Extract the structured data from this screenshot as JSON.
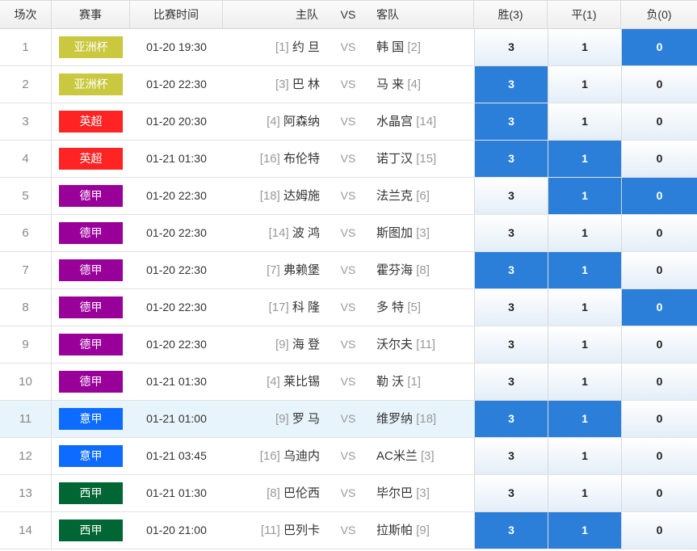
{
  "headers": {
    "no": "场次",
    "league": "赛事",
    "time": "比赛时间",
    "home": "主队",
    "vs": "VS",
    "away": "客队",
    "win": "胜(3)",
    "draw": "平(1)",
    "lose": "负(0)"
  },
  "colors": {
    "亚洲杯": "#c9c83e",
    "英超": "#ff2323",
    "德甲": "#990099",
    "意甲": "#0d6cff",
    "西甲": "#006633",
    "selected": "#2b7fd9"
  },
  "highlight_row": 10,
  "rows": [
    {
      "no": "1",
      "league": "亚洲杯",
      "time": "01-20 19:30",
      "home_rank": "[1]",
      "home": "约 旦",
      "vs": "VS",
      "away": "韩 国",
      "away_rank": "[2]",
      "win": "3",
      "draw": "1",
      "lose": "0",
      "sel": [
        false,
        false,
        true
      ]
    },
    {
      "no": "2",
      "league": "亚洲杯",
      "time": "01-20 22:30",
      "home_rank": "[3]",
      "home": "巴 林",
      "vs": "VS",
      "away": "马 来",
      "away_rank": "[4]",
      "win": "3",
      "draw": "1",
      "lose": "0",
      "sel": [
        true,
        false,
        false
      ]
    },
    {
      "no": "3",
      "league": "英超",
      "time": "01-20 20:30",
      "home_rank": "[4]",
      "home": "阿森纳",
      "vs": "VS",
      "away": "水晶宫",
      "away_rank": "[14]",
      "win": "3",
      "draw": "1",
      "lose": "0",
      "sel": [
        true,
        false,
        false
      ]
    },
    {
      "no": "4",
      "league": "英超",
      "time": "01-21 01:30",
      "home_rank": "[16]",
      "home": "布伦特",
      "vs": "VS",
      "away": "诺丁汉",
      "away_rank": "[15]",
      "win": "3",
      "draw": "1",
      "lose": "0",
      "sel": [
        true,
        true,
        false
      ]
    },
    {
      "no": "5",
      "league": "德甲",
      "time": "01-20 22:30",
      "home_rank": "[18]",
      "home": "达姆施",
      "vs": "VS",
      "away": "法兰克",
      "away_rank": "[6]",
      "win": "3",
      "draw": "1",
      "lose": "0",
      "sel": [
        false,
        true,
        true
      ]
    },
    {
      "no": "6",
      "league": "德甲",
      "time": "01-20 22:30",
      "home_rank": "[14]",
      "home": "波 鸿",
      "vs": "VS",
      "away": "斯图加",
      "away_rank": "[3]",
      "win": "3",
      "draw": "1",
      "lose": "0",
      "sel": [
        false,
        false,
        false
      ]
    },
    {
      "no": "7",
      "league": "德甲",
      "time": "01-20 22:30",
      "home_rank": "[7]",
      "home": "弗赖堡",
      "vs": "VS",
      "away": "霍芬海",
      "away_rank": "[8]",
      "win": "3",
      "draw": "1",
      "lose": "0",
      "sel": [
        true,
        true,
        false
      ]
    },
    {
      "no": "8",
      "league": "德甲",
      "time": "01-20 22:30",
      "home_rank": "[17]",
      "home": "科 隆",
      "vs": "VS",
      "away": "多 特",
      "away_rank": "[5]",
      "win": "3",
      "draw": "1",
      "lose": "0",
      "sel": [
        false,
        false,
        true
      ]
    },
    {
      "no": "9",
      "league": "德甲",
      "time": "01-20 22:30",
      "home_rank": "[9]",
      "home": "海 登",
      "vs": "VS",
      "away": "沃尔夫",
      "away_rank": "[11]",
      "win": "3",
      "draw": "1",
      "lose": "0",
      "sel": [
        false,
        false,
        false
      ]
    },
    {
      "no": "10",
      "league": "德甲",
      "time": "01-21 01:30",
      "home_rank": "[4]",
      "home": "莱比锡",
      "vs": "VS",
      "away": "勒 沃",
      "away_rank": "[1]",
      "win": "3",
      "draw": "1",
      "lose": "0",
      "sel": [
        false,
        false,
        false
      ]
    },
    {
      "no": "11",
      "league": "意甲",
      "time": "01-21 01:00",
      "home_rank": "[9]",
      "home": "罗 马",
      "vs": "VS",
      "away": "维罗纳",
      "away_rank": "[18]",
      "win": "3",
      "draw": "1",
      "lose": "0",
      "sel": [
        true,
        true,
        false
      ]
    },
    {
      "no": "12",
      "league": "意甲",
      "time": "01-21 03:45",
      "home_rank": "[16]",
      "home": "乌迪内",
      "vs": "VS",
      "away": "AC米兰",
      "away_rank": "[3]",
      "win": "3",
      "draw": "1",
      "lose": "0",
      "sel": [
        false,
        false,
        false
      ]
    },
    {
      "no": "13",
      "league": "西甲",
      "time": "01-21 01:30",
      "home_rank": "[8]",
      "home": "巴伦西",
      "vs": "VS",
      "away": "毕尔巴",
      "away_rank": "[3]",
      "win": "3",
      "draw": "1",
      "lose": "0",
      "sel": [
        false,
        false,
        false
      ]
    },
    {
      "no": "14",
      "league": "西甲",
      "time": "01-20 21:00",
      "home_rank": "[11]",
      "home": "巴列卡",
      "vs": "VS",
      "away": "拉斯帕",
      "away_rank": "[9]",
      "win": "3",
      "draw": "1",
      "lose": "0",
      "sel": [
        true,
        true,
        false
      ]
    }
  ]
}
